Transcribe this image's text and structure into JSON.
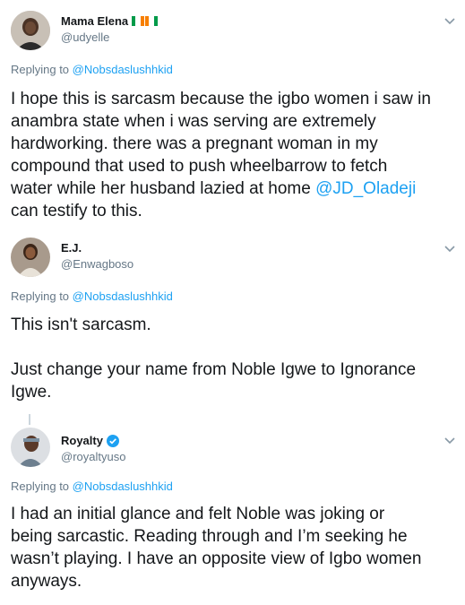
{
  "colors": {
    "link": "#1da1f2",
    "muted": "#657786",
    "text": "#14171a",
    "verified": "#1da1f2"
  },
  "tweets": [
    {
      "name": "Mama Elena",
      "handle": "@udyelle",
      "flag_icon": "ivory-coast-flag-icon",
      "replying_prefix": "Replying to",
      "replying_to": "@Nobsdaslushhkid",
      "body_lines": [
        "I hope this is sarcasm because the igbo women i saw in",
        "anambra state when i was serving are extremely",
        "hardworking. there was a pregnant woman in my",
        "compound that used to push wheelbarrow to fetch",
        "water while her husband lazied at home "
      ],
      "body_mention": "@JD_Oladeji",
      "body_tail": "can testify to this."
    },
    {
      "name": "E.J.",
      "handle": "@Enwagboso",
      "replying_prefix": "Replying to",
      "replying_to": "@Nobsdaslushhkid",
      "body_p1": "This isn't sarcasm.",
      "body_p2_lines": [
        "Just change your name from Noble Igwe to Ignorance",
        "Igwe."
      ]
    },
    {
      "name": "Royalty",
      "handle": "@royaltyuso",
      "verified_icon": "verified-badge-icon",
      "replying_prefix": "Replying to",
      "replying_to": "@Nobsdaslushhkid",
      "body_lines": [
        "I had an initial glance and felt Noble was joking or",
        "being sarcastic. Reading through and I’m seeking he",
        "wasn’t playing. I have an opposite view of Igbo women",
        "anyways."
      ]
    }
  ]
}
